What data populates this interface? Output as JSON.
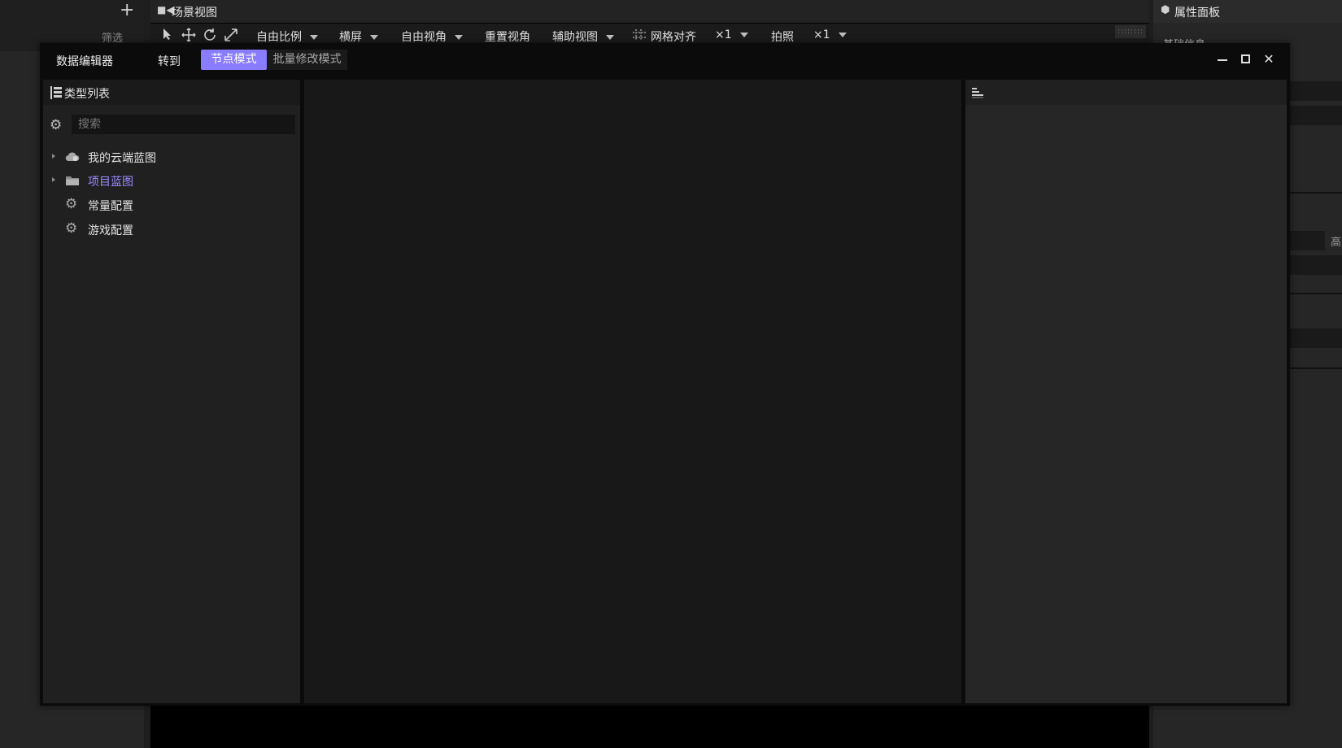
{
  "background": {
    "left_panel": {
      "add_icon": "plus-icon",
      "filter_label": "筛选"
    },
    "scene_view": {
      "title": "场景视图",
      "toolbar": {
        "tools": [
          "select-arrow-icon",
          "move-icon",
          "rotate-icon",
          "scale-icon"
        ],
        "aspect_label": "自由比例",
        "orientation_label": "横屏",
        "view_label": "自由视角",
        "reset_view_label": "重置视角",
        "aux_view_label": "辅助视图",
        "grid_snap_label": "网格对齐",
        "grid_multiplier": "×1",
        "snapshot_label": "拍照",
        "snapshot_multiplier": "×1"
      }
    },
    "property_panel": {
      "title": "属性面板",
      "subsection": "基础信息",
      "side_label": "高"
    }
  },
  "editor": {
    "title": "数据编辑器",
    "goto_label": "转到",
    "modes": {
      "node": "节点模式",
      "batch": "批量修改模式"
    },
    "active_mode": "node",
    "accent": "#8a7cff",
    "window_buttons": [
      "minimize-icon",
      "maximize-icon",
      "close-icon"
    ],
    "type_list": {
      "title": "类型列表",
      "search_placeholder": "搜索",
      "items": [
        {
          "label": "我的云端蓝图",
          "icon": "cloud-icon",
          "expandable": true,
          "selected": false
        },
        {
          "label": "项目蓝图",
          "icon": "folder-icon",
          "expandable": true,
          "selected": true
        },
        {
          "label": "常量配置",
          "icon": "gear-icon",
          "expandable": false,
          "selected": false
        },
        {
          "label": "游戏配置",
          "icon": "gear-icon",
          "expandable": false,
          "selected": false
        }
      ]
    },
    "detail_panel": {
      "header_icon": "align-left-icon"
    }
  }
}
